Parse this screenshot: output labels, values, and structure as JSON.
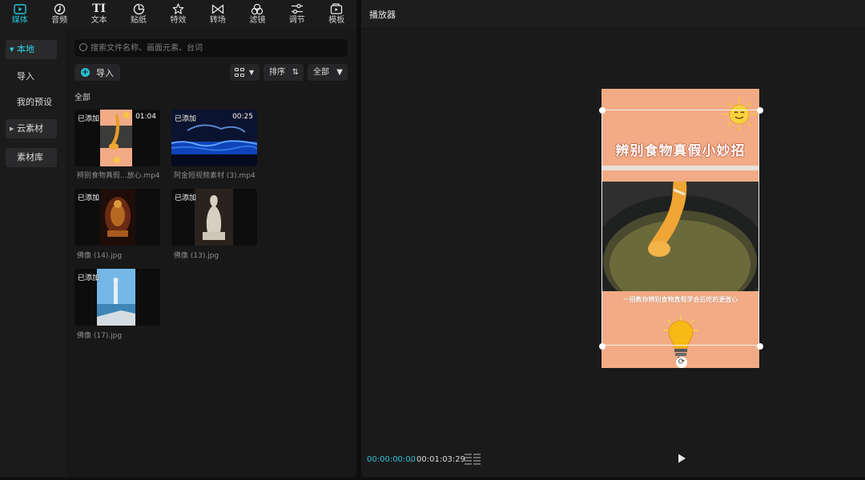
{
  "tabs": [
    {
      "label": "媒体",
      "icon": "media-icon",
      "active": true
    },
    {
      "label": "音频",
      "icon": "audio-icon"
    },
    {
      "label": "文本",
      "icon": "text-icon",
      "glyph": "TI"
    },
    {
      "label": "贴纸",
      "icon": "sticker-icon"
    },
    {
      "label": "特效",
      "icon": "effects-icon"
    },
    {
      "label": "转场",
      "icon": "transition-icon"
    },
    {
      "label": "滤镜",
      "icon": "filter-icon"
    },
    {
      "label": "调节",
      "icon": "adjust-icon"
    },
    {
      "label": "模板",
      "icon": "template-icon"
    }
  ],
  "sidebar": {
    "items": [
      {
        "label": "本地",
        "active": true
      },
      {
        "label": "导入"
      },
      {
        "label": "我的预设"
      },
      {
        "label": "云素材"
      },
      {
        "label": "素材库"
      }
    ]
  },
  "media": {
    "search_placeholder": "搜索文件名称、画面元素、台词",
    "import_label": "导入",
    "sort_label": "排序",
    "filter_label": "全部",
    "section_label": "全部",
    "items": [
      {
        "badge": "已添加",
        "duration": "01:04",
        "name": "辨别食物真假...放心.mp4"
      },
      {
        "badge": "已添加",
        "duration": "00:25",
        "name": "阿金短视频素材 (3).mp4"
      },
      {
        "badge": "已添加",
        "name": "佛像 (14).jpg"
      },
      {
        "badge": "已添加",
        "name": "佛像 (13).jpg"
      },
      {
        "badge": "已添加",
        "name": "佛像 (17).jpg"
      }
    ]
  },
  "player": {
    "title": "播放器",
    "current_time": "00:00:00:00",
    "separator": "/",
    "total_time": "00:01:03:29",
    "preview_title": "辨别食物真假小妙招",
    "preview_subtitle": "一招教你辨别食物真假学会后吃的更放心"
  },
  "colors": {
    "accent": "#22c6d6",
    "preview_bg": "#f2ab85"
  }
}
